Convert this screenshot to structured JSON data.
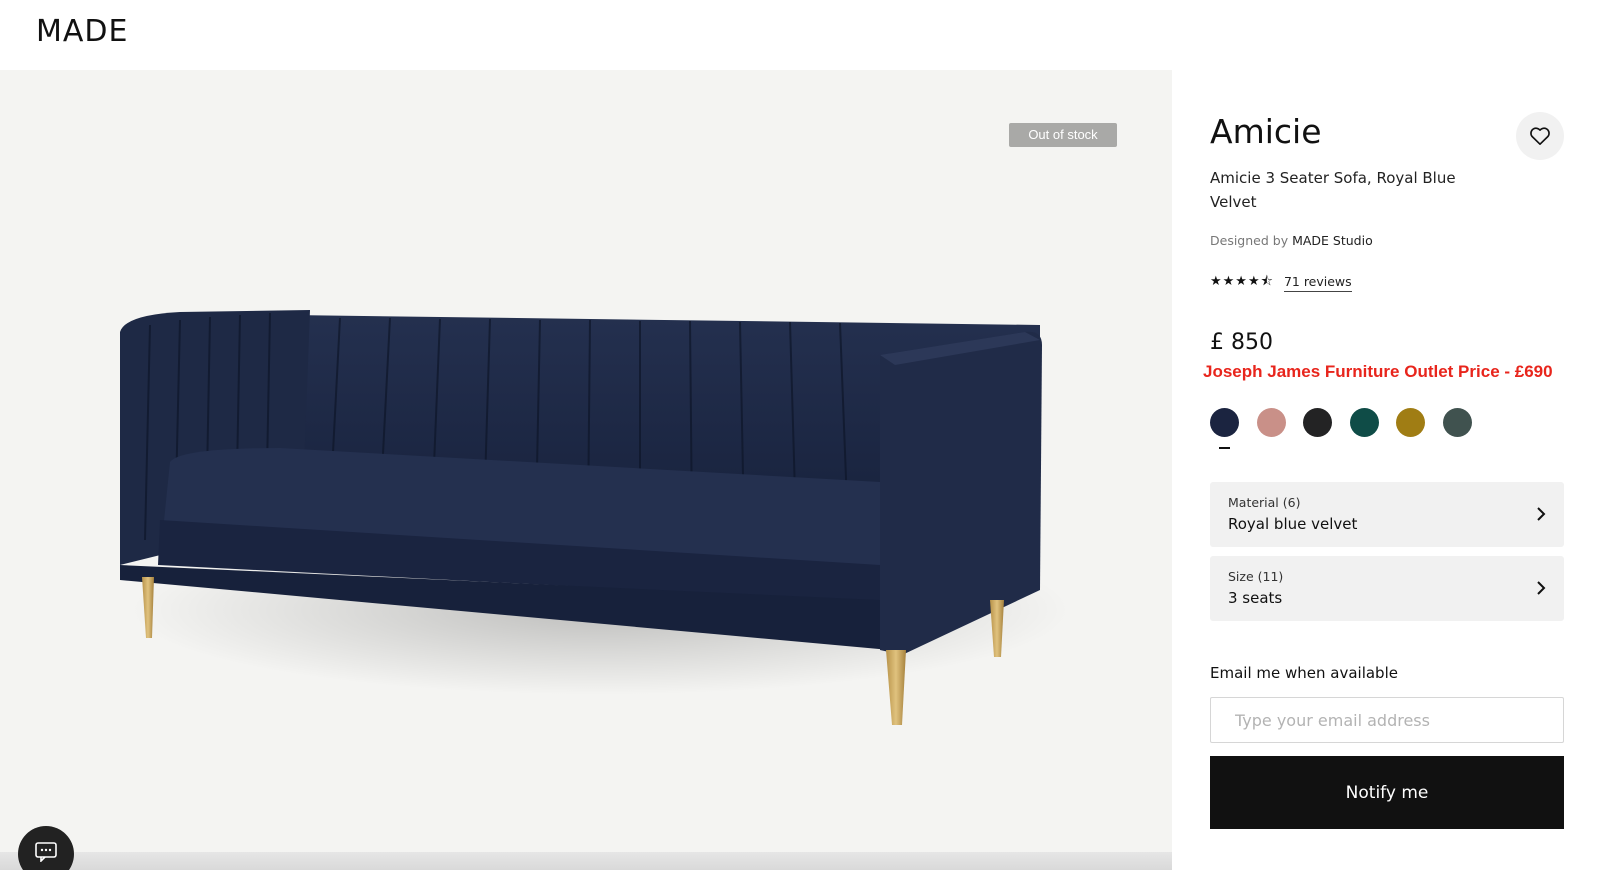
{
  "brand": {
    "logo": "MADE"
  },
  "gallery": {
    "badge": "Out of stock",
    "image": "royal-blue-velvet-3-seater-sofa-photo"
  },
  "product": {
    "name": "Amicie",
    "subtitle": "Amicie 3 Seater Sofa, Royal Blue Velvet",
    "designed_by_label": "Designed by",
    "designer": "MADE Studio",
    "rating": 4.5,
    "stars_display": "★★★★⯪",
    "reviews_label": "71 reviews",
    "price": "£ 850",
    "outlet_note": "Joseph James Furniture Outlet Price - £690"
  },
  "swatches": [
    {
      "name": "royal-blue",
      "color": "#1b2440",
      "selected": true
    },
    {
      "name": "dusty-pink",
      "color": "#c99088",
      "selected": false
    },
    {
      "name": "black",
      "color": "#232324",
      "selected": false
    },
    {
      "name": "teal",
      "color": "#0f4c47",
      "selected": false
    },
    {
      "name": "mustard",
      "color": "#a07d14",
      "selected": false
    },
    {
      "name": "slate-grey",
      "color": "#40524f",
      "selected": false
    }
  ],
  "options": {
    "material": {
      "label": "Material (6)",
      "value": "Royal blue velvet"
    },
    "size": {
      "label": "Size (11)",
      "value": "3 seats"
    }
  },
  "notify": {
    "heading": "Email me when available",
    "placeholder": "Type your email address",
    "button": "Notify me"
  },
  "icons": {
    "favourite": "heart-icon",
    "chevron": "chevron-right-icon",
    "chat": "chat-bubble-icon"
  },
  "colors": {
    "outlet_text": "#e8251c",
    "button_bg": "#111111",
    "badge_bg": "#a9a9a7"
  }
}
